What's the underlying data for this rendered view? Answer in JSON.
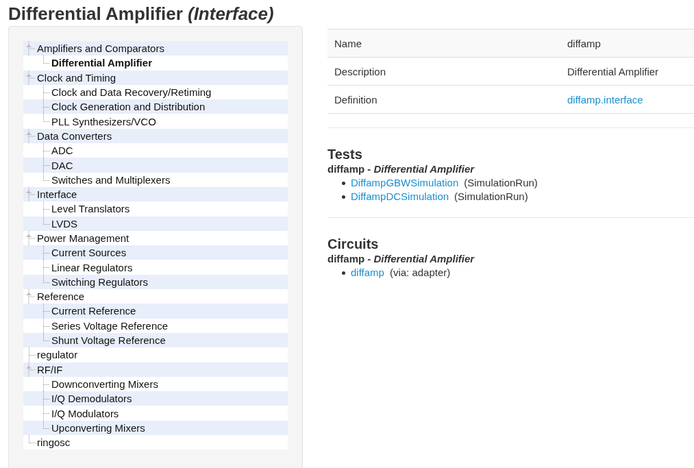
{
  "title": "Differential Amplifier *(Interface)*",
  "tree": [
    {
      "label": "Amplifiers and Comparators",
      "selected": false,
      "children": [
        {
          "label": "Differential Amplifier",
          "selected": true
        }
      ]
    },
    {
      "label": "Clock and Timing",
      "selected": false,
      "children": [
        {
          "label": "Clock and Data Recovery/Retiming",
          "selected": false
        },
        {
          "label": "Clock Generation and Distribution",
          "selected": false
        },
        {
          "label": "PLL Synthesizers/VCO",
          "selected": false
        }
      ]
    },
    {
      "label": "Data Converters",
      "selected": false,
      "children": [
        {
          "label": "ADC",
          "selected": false
        },
        {
          "label": "DAC",
          "selected": false
        },
        {
          "label": "Switches and Multiplexers",
          "selected": false
        }
      ]
    },
    {
      "label": "Interface",
      "selected": false,
      "children": [
        {
          "label": "Level Translators",
          "selected": false
        },
        {
          "label": "LVDS",
          "selected": false
        }
      ]
    },
    {
      "label": "Power Management",
      "selected": false,
      "children": [
        {
          "label": "Current Sources",
          "selected": false
        },
        {
          "label": "Linear Regulators",
          "selected": false
        },
        {
          "label": "Switching Regulators",
          "selected": false
        }
      ]
    },
    {
      "label": "Reference",
      "selected": false,
      "children": [
        {
          "label": "Current Reference",
          "selected": false
        },
        {
          "label": "Series Voltage Reference",
          "selected": false
        },
        {
          "label": "Shunt Voltage Reference",
          "selected": false
        }
      ]
    },
    {
      "label": "regulator",
      "selected": false
    },
    {
      "label": "RF/IF",
      "selected": false,
      "children": [
        {
          "label": "Downconverting Mixers",
          "selected": false
        },
        {
          "label": "I/Q Demodulators",
          "selected": false
        },
        {
          "label": "I/Q Modulators",
          "selected": false
        },
        {
          "label": "Upconverting Mixers",
          "selected": false
        }
      ]
    },
    {
      "label": "ringosc",
      "selected": false
    }
  ],
  "properties": [
    {
      "name": "Name",
      "value": "diffamp",
      "kind": "text"
    },
    {
      "name": "Description",
      "value": "Differential Amplifier",
      "kind": "text"
    },
    {
      "name": "Definition",
      "value": "diffamp.interface",
      "kind": "link"
    }
  ],
  "sections": [
    {
      "heading": "Tests",
      "subheading": "diffamp - *Differential Amplifier*",
      "items": [
        {
          "link": "DiffampGBWSimulation",
          "note": "(SimulationRun)"
        },
        {
          "link": "DiffampDCSimulation",
          "note": "(SimulationRun)"
        }
      ]
    },
    {
      "heading": "Circuits",
      "subheading": "diffamp - *Differential Amplifier*",
      "items": [
        {
          "link": "diffamp",
          "note": "(via: adapter)"
        }
      ]
    }
  ]
}
